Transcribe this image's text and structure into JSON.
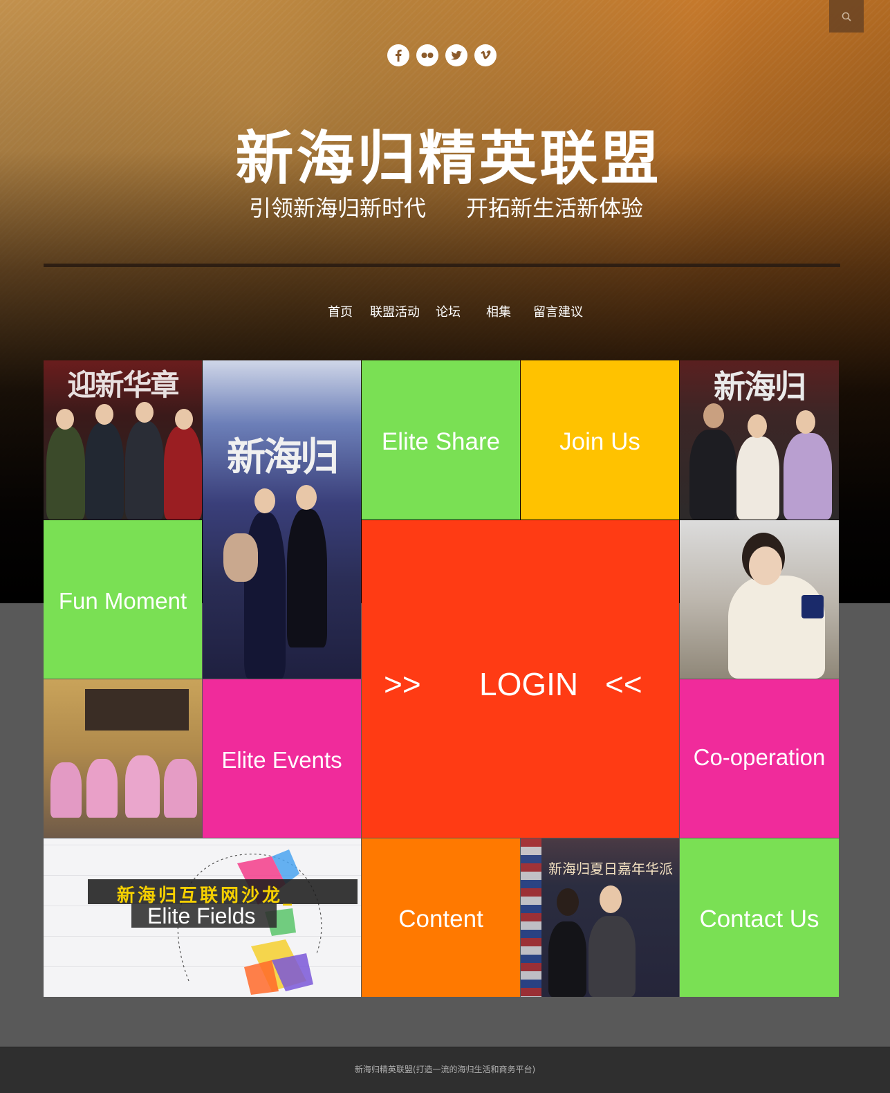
{
  "site": {
    "title": "新海归精英联盟",
    "slogan_left": "引领新海归新时代",
    "slogan_right": "开拓新生活新体验"
  },
  "social_icons": [
    "facebook-icon",
    "flickr-icon",
    "twitter-icon",
    "vimeo-icon"
  ],
  "nav": {
    "items": [
      "首页",
      "联盟活动",
      "论坛",
      "相集",
      "留言建议"
    ]
  },
  "tiles": {
    "elite_share": "Elite Share",
    "join_us": "Join Us",
    "fun_moment": "Fun Moment",
    "login_left": ">>",
    "login": "LOGIN",
    "login_right": "<<",
    "elite_events": "Elite Events",
    "cooperation": "Co-operation",
    "elite_fields_cn": "新海归互联网沙龙_",
    "elite_fields": "Elite Fields",
    "content": "Content",
    "contact_us": "Contact Us"
  },
  "photo_text": {
    "banner1": "迎新华章",
    "banner2": "新海归",
    "banner3": "新海归",
    "event_banner": "新海归夏日嘉年华派"
  },
  "colors": {
    "green": "#7ae054",
    "yellow": "#ffc200",
    "magenta": "#f02b9b",
    "red": "#ff3b14",
    "orange": "#ff7900"
  },
  "footer": {
    "text": "新海归精英联盟(打造一流的海归生活和商务平台)"
  }
}
